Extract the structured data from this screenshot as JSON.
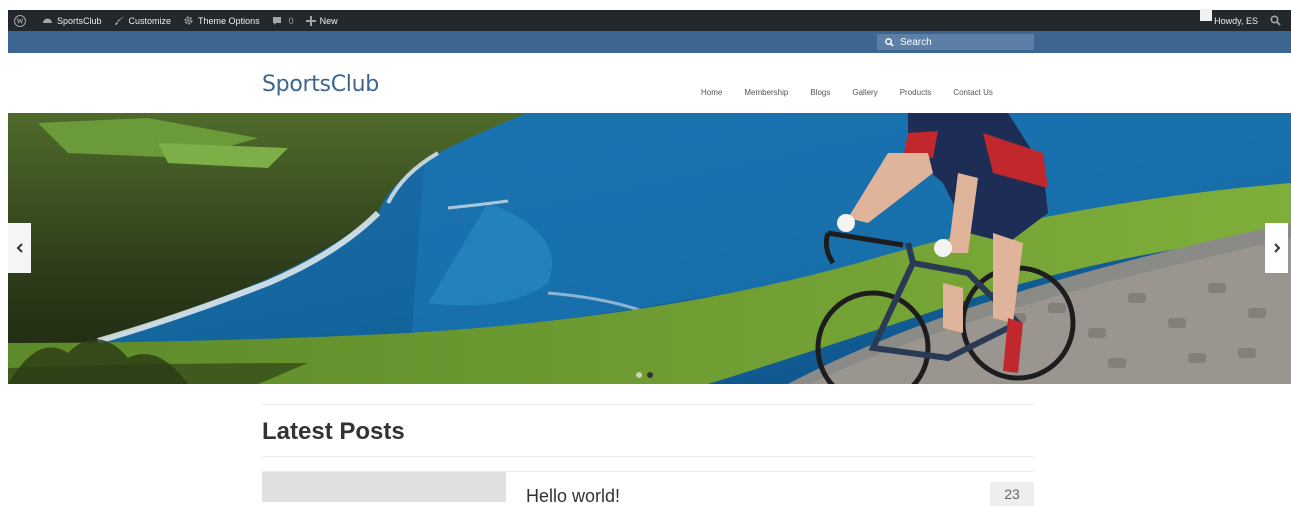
{
  "admin_bar": {
    "site_name": "SportsClub",
    "customize": "Customize",
    "theme_options": "Theme Options",
    "comments_count": "0",
    "new_label": "New",
    "howdy": "Howdy, ES"
  },
  "top_bar": {
    "search_placeholder": "Search"
  },
  "header": {
    "site_title": "SportsClub",
    "nav": [
      "Home",
      "Membership",
      "Blogs",
      "Gallery",
      "Products",
      "Contact Us"
    ]
  },
  "slider": {
    "slide_count": 2,
    "active_slide": 2,
    "image": "cyclist riding along a coastal cliff road"
  },
  "main": {
    "section_title": "Latest Posts",
    "first_post_title": "Hello world!",
    "first_post_date": "23"
  },
  "colors": {
    "admin_bar": "#23282d",
    "brand_blue": "#3c6590"
  }
}
